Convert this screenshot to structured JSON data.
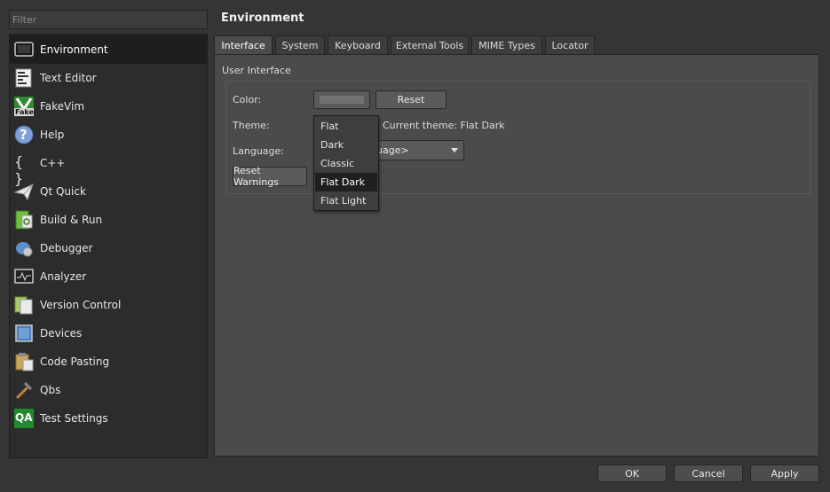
{
  "filter": {
    "placeholder": "Filter",
    "value": ""
  },
  "sidebar": {
    "items": [
      {
        "label": "Environment",
        "icon": "monitor-icon",
        "active": true
      },
      {
        "label": "Text Editor",
        "icon": "text-editor-icon"
      },
      {
        "label": "FakeVim",
        "icon": "fakevim-icon",
        "icon_text": "Fake"
      },
      {
        "label": "Help",
        "icon": "help-icon",
        "icon_text": "?"
      },
      {
        "label": "C++",
        "icon": "cpp-braces-icon",
        "icon_text": "{ }"
      },
      {
        "label": "Qt Quick",
        "icon": "paper-plane-icon"
      },
      {
        "label": "Build & Run",
        "icon": "build-run-icon"
      },
      {
        "label": "Debugger",
        "icon": "debugger-icon"
      },
      {
        "label": "Analyzer",
        "icon": "analyzer-icon"
      },
      {
        "label": "Version Control",
        "icon": "version-control-icon"
      },
      {
        "label": "Devices",
        "icon": "devices-icon"
      },
      {
        "label": "Code Pasting",
        "icon": "code-pasting-icon"
      },
      {
        "label": "Qbs",
        "icon": "hammer-icon"
      },
      {
        "label": "Test Settings",
        "icon": "qa-icon",
        "icon_text": "QA"
      }
    ]
  },
  "header": {
    "title": "Environment"
  },
  "tabs": [
    {
      "label": "Interface",
      "active": true
    },
    {
      "label": "System"
    },
    {
      "label": "Keyboard"
    },
    {
      "label": "External Tools"
    },
    {
      "label": "MIME Types"
    },
    {
      "label": "Locator"
    }
  ],
  "interface": {
    "group_title": "User Interface",
    "color_label": "Color:",
    "reset_label": "Reset",
    "theme_label": "Theme:",
    "current_theme_text": "Current theme: Flat Dark",
    "language_label": "Language:",
    "language_value_visible": "uage>",
    "reset_warnings_label": "Reset Warnings",
    "theme_options": [
      "Flat",
      "Dark",
      "Classic",
      "Flat Dark",
      "Flat Light"
    ],
    "theme_selected": "Flat Dark"
  },
  "buttons": {
    "ok": "OK",
    "cancel": "Cancel",
    "apply": "Apply"
  },
  "colors": {
    "background": "#353535",
    "sidebar": "#2c2c2c",
    "panel": "#4b4b4b",
    "selection": "#1f1f1f"
  }
}
